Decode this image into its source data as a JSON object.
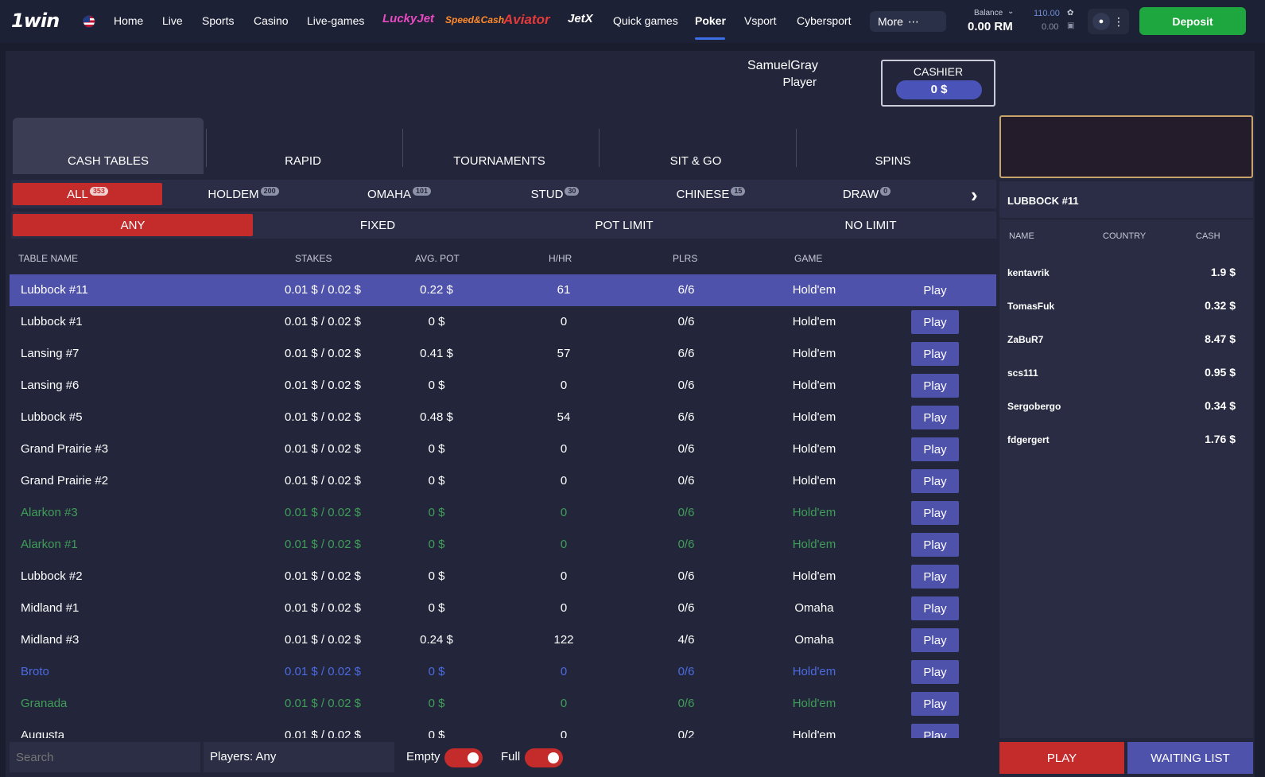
{
  "header": {
    "logo": "1win",
    "nav": [
      "Home",
      "Live",
      "Sports",
      "Casino",
      "Live-games"
    ],
    "brands": [
      "LuckyJet",
      "Speed&Cash",
      "Aviator",
      "JetX"
    ],
    "nav2": [
      "Quick games",
      "Poker",
      "Vsport",
      "Cybersport"
    ],
    "more": "More",
    "balance_label": "Balance",
    "balance_value": "0.00 RM",
    "sub_balance_1": "110.00",
    "sub_balance_2": "0.00",
    "deposit": "Deposit",
    "colors": {
      "deposit": "#1fa73f",
      "active_nav": "#3d6ee6"
    }
  },
  "user": {
    "name": "SamuelGray",
    "role": "Player"
  },
  "cashier": {
    "label": "CASHIER",
    "value": "0 $"
  },
  "tabs": [
    "CASH TABLES",
    "RAPID",
    "TOURNAMENTS",
    "SIT & GO",
    "SPINS"
  ],
  "game_filters": [
    {
      "label": "ALL",
      "count": "353"
    },
    {
      "label": "HOLDEM",
      "count": "200"
    },
    {
      "label": "OMAHA",
      "count": "101"
    },
    {
      "label": "STUD",
      "count": "30"
    },
    {
      "label": "CHINESE",
      "count": "15"
    },
    {
      "label": "DRAW",
      "count": "0"
    }
  ],
  "limit_filters": [
    "ANY",
    "FIXED",
    "POT LIMIT",
    "NO LIMIT"
  ],
  "table_headers": [
    "TABLE NAME",
    "STAKES",
    "AVG. POT",
    "H/HR",
    "PLRS",
    "GAME"
  ],
  "play_label": "Play",
  "rows": [
    {
      "name": "Lubbock #11",
      "stakes": "0.01 $ / 0.02 $",
      "pot": "0.22 $",
      "hhr": "61",
      "plrs": "6/6",
      "game": "Hold'em"
    },
    {
      "name": "Lubbock #1",
      "stakes": "0.01 $ / 0.02 $",
      "pot": "0 $",
      "hhr": "0",
      "plrs": "0/6",
      "game": "Hold'em"
    },
    {
      "name": "Lansing #7",
      "stakes": "0.01 $ / 0.02 $",
      "pot": "0.41 $",
      "hhr": "57",
      "plrs": "6/6",
      "game": "Hold'em"
    },
    {
      "name": "Lansing #6",
      "stakes": "0.01 $ / 0.02 $",
      "pot": "0 $",
      "hhr": "0",
      "plrs": "0/6",
      "game": "Hold'em"
    },
    {
      "name": "Lubbock #5",
      "stakes": "0.01 $ / 0.02 $",
      "pot": "0.48 $",
      "hhr": "54",
      "plrs": "6/6",
      "game": "Hold'em"
    },
    {
      "name": "Grand Prairie #3",
      "stakes": "0.01 $ / 0.02 $",
      "pot": "0 $",
      "hhr": "0",
      "plrs": "0/6",
      "game": "Hold'em"
    },
    {
      "name": "Grand Prairie #2",
      "stakes": "0.01 $ / 0.02 $",
      "pot": "0 $",
      "hhr": "0",
      "plrs": "0/6",
      "game": "Hold'em"
    },
    {
      "name": "Alarkon #3",
      "stakes": "0.01 $ / 0.02 $",
      "pot": "0 $",
      "hhr": "0",
      "plrs": "0/6",
      "game": "Hold'em"
    },
    {
      "name": "Alarkon #1",
      "stakes": "0.01 $ / 0.02 $",
      "pot": "0 $",
      "hhr": "0",
      "plrs": "0/6",
      "game": "Hold'em"
    },
    {
      "name": "Lubbock #2",
      "stakes": "0.01 $ / 0.02 $",
      "pot": "0 $",
      "hhr": "0",
      "plrs": "0/6",
      "game": "Hold'em"
    },
    {
      "name": "Midland #1",
      "stakes": "0.01 $ / 0.02 $",
      "pot": "0 $",
      "hhr": "0",
      "plrs": "0/6",
      "game": "Omaha"
    },
    {
      "name": "Midland #3",
      "stakes": "0.01 $ / 0.02 $",
      "pot": "0.24 $",
      "hhr": "122",
      "plrs": "4/6",
      "game": "Omaha"
    },
    {
      "name": "Broto",
      "stakes": "0.01 $ / 0.02 $",
      "pot": "0 $",
      "hhr": "0",
      "plrs": "0/6",
      "game": "Hold'em"
    },
    {
      "name": "Granada",
      "stakes": "0.01 $ / 0.02 $",
      "pot": "0 $",
      "hhr": "0",
      "plrs": "0/6",
      "game": "Hold'em"
    },
    {
      "name": "Augusta",
      "stakes": "0.01 $ / 0.02 $",
      "pot": "0 $",
      "hhr": "0",
      "plrs": "0/2",
      "game": "Hold'em"
    }
  ],
  "bottom": {
    "search_placeholder": "Search",
    "players": "Players: Any",
    "empty": "Empty",
    "full": "Full"
  },
  "side": {
    "title": "LUBBOCK #11",
    "headers": [
      "NAME",
      "COUNTRY",
      "CASH"
    ],
    "players": [
      {
        "name": "kentavrik",
        "cash": "1.9 $"
      },
      {
        "name": "TomasFuk",
        "cash": "0.32 $"
      },
      {
        "name": "ZaBuR7",
        "cash": "8.47 $"
      },
      {
        "name": "scs111",
        "cash": "0.95 $"
      },
      {
        "name": "Sergobergo",
        "cash": "0.34 $"
      },
      {
        "name": "fdgergert",
        "cash": "1.76 $"
      }
    ],
    "play": "PLAY",
    "waiting": "WAITING LIST"
  }
}
